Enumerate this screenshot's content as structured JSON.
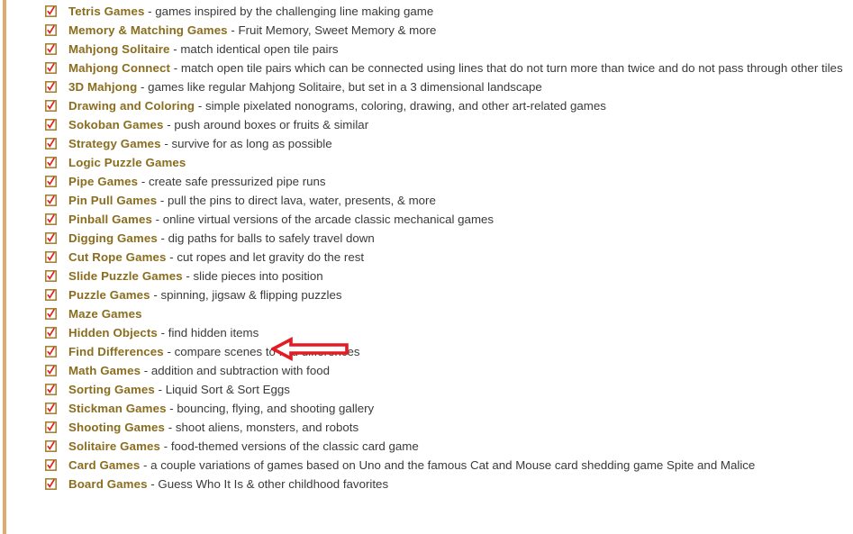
{
  "page": {
    "background_color": "#ffffff",
    "left_border_color": "#e0a96d",
    "title_color": "#8a6d1e",
    "description_color": "#3a3a3a",
    "checkbox_box_color": "#a07b28",
    "checkbox_check_color": "#e02020",
    "annotation_color": "#e31b23"
  },
  "annotation": {
    "shape": "left-arrow",
    "color": "#e31b23",
    "points_at": "Hidden Objects"
  },
  "list": {
    "items": [
      {
        "title": "Tetris Games",
        "desc": " - games inspired by the challenging line making game"
      },
      {
        "title": "Memory & Matching Games",
        "desc": " - Fruit Memory, Sweet Memory & more"
      },
      {
        "title": "Mahjong Solitaire",
        "desc": " - match identical open tile pairs"
      },
      {
        "title": "Mahjong Connect",
        "desc": " - match open tile pairs which can be connected using lines that do not turn more than twice and do not pass through other tiles"
      },
      {
        "title": "3D Mahjong",
        "desc": " - games like regular Mahjong Solitaire, but set in a 3 dimensional landscape"
      },
      {
        "title": "Drawing and Coloring",
        "desc": " - simple pixelated nonograms, coloring, drawing, and other art-related games"
      },
      {
        "title": "Sokoban Games",
        "desc": " - push around boxes or fruits & similar"
      },
      {
        "title": "Strategy Games",
        "desc": " - survive for as long as possible"
      },
      {
        "title": "Logic Puzzle Games",
        "desc": ""
      },
      {
        "title": "Pipe Games",
        "desc": " - create safe pressurized pipe runs"
      },
      {
        "title": "Pin Pull Games",
        "desc": " - pull the pins to direct lava, water, presents, & more"
      },
      {
        "title": "Pinball Games",
        "desc": " - online virtual versions of the arcade classic mechanical games"
      },
      {
        "title": "Digging Games",
        "desc": " - dig paths for balls to safely travel down"
      },
      {
        "title": "Cut Rope Games",
        "desc": " - cut ropes and let gravity do the rest"
      },
      {
        "title": "Slide Puzzle Games",
        "desc": " - slide pieces into position"
      },
      {
        "title": "Puzzle Games",
        "desc": " - spinning, jigsaw & flipping puzzles"
      },
      {
        "title": "Maze Games",
        "desc": ""
      },
      {
        "title": "Hidden Objects",
        "desc": " - find hidden items"
      },
      {
        "title": "Find Differences",
        "desc": " - compare scenes to find differences"
      },
      {
        "title": "Math Games",
        "desc": " - addition and subtraction with food"
      },
      {
        "title": "Sorting Games",
        "desc": " - Liquid Sort & Sort Eggs"
      },
      {
        "title": "Stickman Games",
        "desc": " - bouncing, flying, and shooting gallery"
      },
      {
        "title": "Shooting Games",
        "desc": " - shoot aliens, monsters, and robots"
      },
      {
        "title": "Solitaire Games",
        "desc": " - food-themed versions of the classic card game"
      },
      {
        "title": "Card Games",
        "desc": " - a couple variations of games based on Uno and the famous Cat and Mouse card shedding game Spite and Malice"
      },
      {
        "title": "Board Games",
        "desc": " - Guess Who It Is & other childhood favorites"
      }
    ]
  }
}
